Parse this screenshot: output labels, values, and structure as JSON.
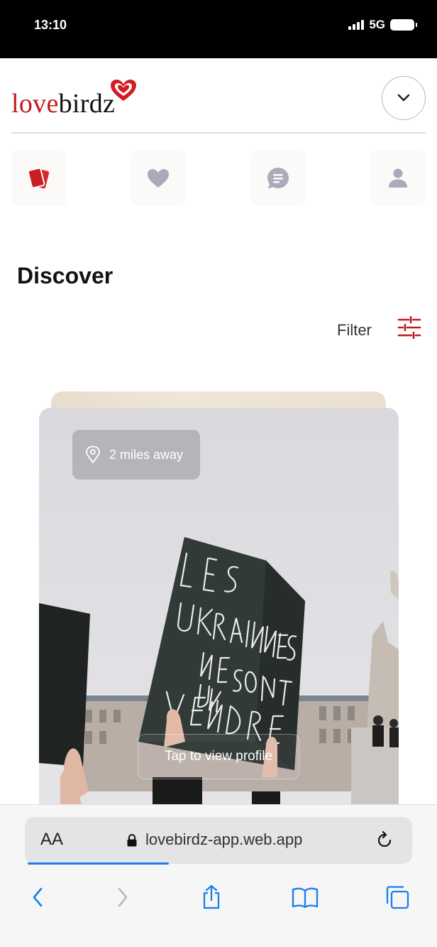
{
  "status_bar": {
    "time": "13:10",
    "network": "5G",
    "signal_bars": 4,
    "battery_level": 1.0
  },
  "header": {
    "logo": {
      "text_red": "love",
      "text_dark": "birdz",
      "heart_icon": "heart-logo-icon"
    },
    "menu_icon": "chevron-down-icon"
  },
  "nav": {
    "items": [
      {
        "name": "cards",
        "icon": "cards-icon",
        "active": true
      },
      {
        "name": "likes",
        "icon": "heart-icon",
        "active": false
      },
      {
        "name": "messages",
        "icon": "chat-bubble-icon",
        "active": false
      },
      {
        "name": "profile",
        "icon": "user-icon",
        "active": false
      }
    ]
  },
  "main": {
    "title": "Discover",
    "filter_label": "Filter",
    "filter_icon": "sliders-icon",
    "card": {
      "distance": "2 miles away",
      "distance_icon": "location-pin-icon",
      "tap_label": "Tap to view profile",
      "photo_sign_text": "LES UKRAINIENNES NE SONT PAS A VENDRE"
    }
  },
  "browser": {
    "aa_label": "AA",
    "url": "lovebirdz-app.web.app",
    "load_progress": 0.37,
    "toolbar_icons": [
      "back-icon",
      "forward-icon",
      "share-icon",
      "bookmarks-icon",
      "tabs-icon"
    ]
  },
  "colors": {
    "brand_red": "#c5191e",
    "nav_inactive": "#a9acb8",
    "accent_blue": "#1a7cf0"
  }
}
